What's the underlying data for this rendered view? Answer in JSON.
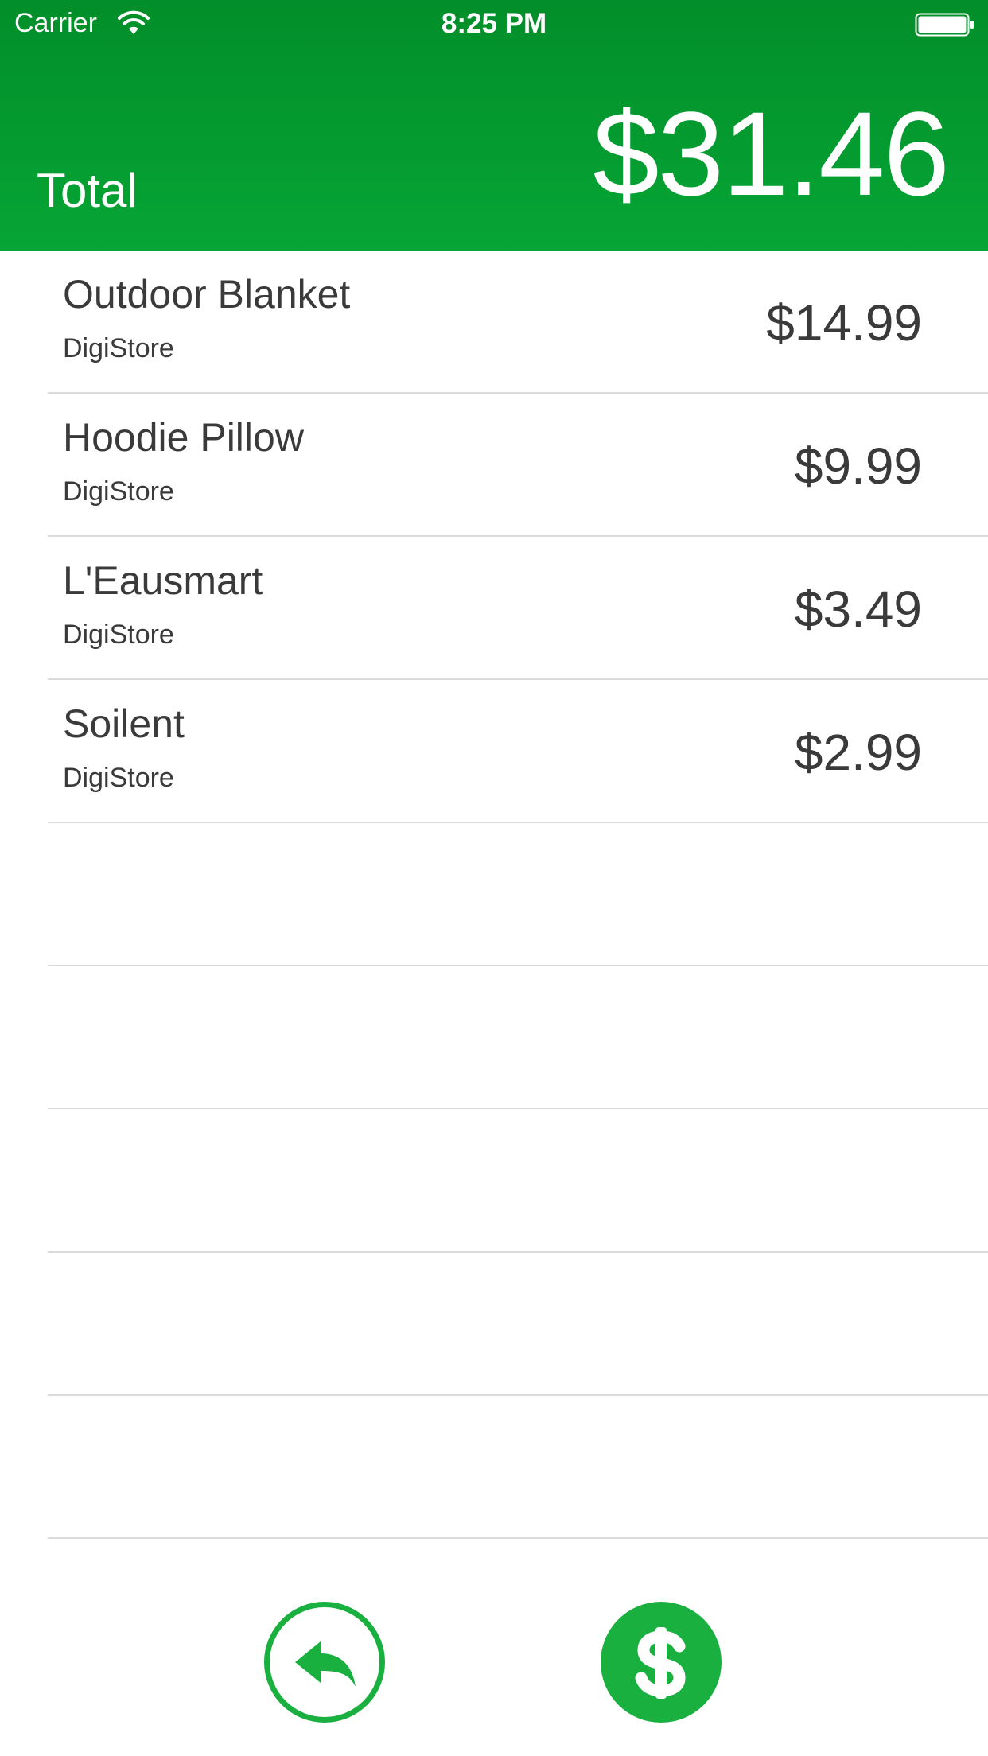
{
  "status_bar": {
    "carrier": "Carrier",
    "time": "8:25 PM",
    "wifi_icon": "wifi-icon",
    "battery_icon": "battery-icon"
  },
  "header": {
    "total_label": "Total",
    "total_amount": "$31.46",
    "background_color": "#06a535"
  },
  "items": [
    {
      "name": "Outdoor Blanket",
      "store": "DigiStore",
      "price": "$14.99"
    },
    {
      "name": "Hoodie Pillow",
      "store": "DigiStore",
      "price": "$9.99"
    },
    {
      "name": "L'Eausmart",
      "store": "DigiStore",
      "price": "$3.49"
    },
    {
      "name": "Soilent",
      "store": "DigiStore",
      "price": "$2.99"
    }
  ],
  "actions": {
    "back_icon": "reply-arrow-icon",
    "pay_icon": "dollar-icon",
    "accent_color": "#1ab040"
  }
}
